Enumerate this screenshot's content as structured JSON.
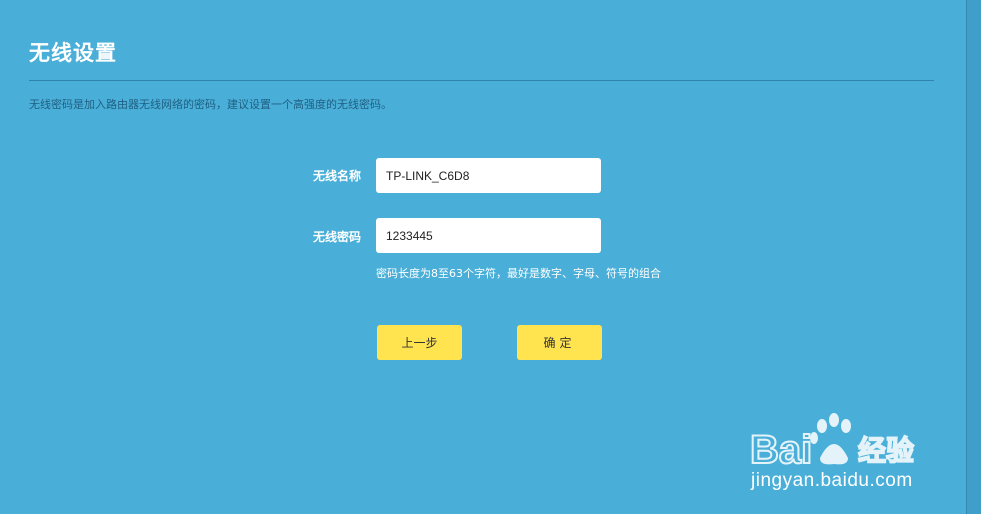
{
  "page": {
    "title": "无线设置",
    "description": "无线密码是加入路由器无线网络的密码，建议设置一个高强度的无线密码。"
  },
  "form": {
    "ssid_label": "无线名称",
    "ssid_value": "TP-LINK_C6D8",
    "password_label": "无线密码",
    "password_value": "1233445",
    "password_hint": "密码长度为8至63个字符，最好是数字、字母、符号的组合"
  },
  "buttons": {
    "prev_label": "上一步",
    "confirm_label": "确定"
  },
  "watermark": {
    "logo_text": "Bai 经验",
    "url": "jingyan.baidu.com"
  },
  "colors": {
    "background": "#4aafd8",
    "button": "#ffe450",
    "text_white": "#ffffff"
  }
}
